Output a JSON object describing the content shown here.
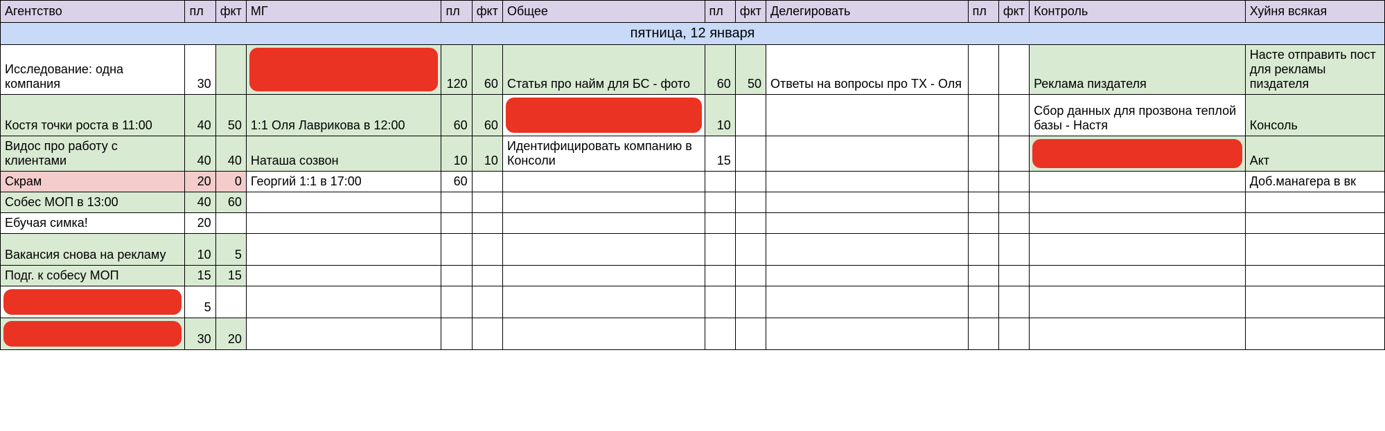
{
  "headers": {
    "agency": "Агентство",
    "pl": "пл",
    "fkt": "фкт",
    "mg": "МГ",
    "general": "Общее",
    "delegate": "Делегировать",
    "control": "Контроль",
    "misc": "Хуйня всякая"
  },
  "date_row": "пятница, 12 января",
  "rows": [
    {
      "agency": {
        "text": "Исследование: одна компания",
        "cls": ""
      },
      "a_pl": "30",
      "a_fkt": "",
      "a_pl_cls": "",
      "a_fkt_cls": "green",
      "mg": {
        "text": "",
        "cls": "green redact"
      },
      "m_pl": "120",
      "m_fkt": "60",
      "m_pl_cls": "green",
      "m_fkt_cls": "green",
      "gen": {
        "text": "Статья про найм для БС - фото",
        "cls": "green"
      },
      "g_pl": "60",
      "g_fkt": "50",
      "g_pl_cls": "green",
      "g_fkt_cls": "green",
      "del": {
        "text": "Ответы на вопросы про ТХ - Оля",
        "cls": ""
      },
      "d_pl": "",
      "d_fkt": "",
      "ctrl": {
        "text": "Реклама пиздателя",
        "cls": "green"
      },
      "misc": {
        "text": "Насте отправить пост для рекламы пиздателя",
        "cls": "green"
      },
      "h": "tall"
    },
    {
      "agency": {
        "text": "Костя точки роста в 11:00",
        "cls": "green"
      },
      "a_pl": "40",
      "a_fkt": "50",
      "a_pl_cls": "green",
      "a_fkt_cls": "green",
      "mg": {
        "text": "1:1 Оля Лаврикова в 12:00",
        "cls": "green"
      },
      "m_pl": "60",
      "m_fkt": "60",
      "m_pl_cls": "green",
      "m_fkt_cls": "green",
      "gen": {
        "text": "",
        "cls": "redact"
      },
      "g_pl": "10",
      "g_fkt": "",
      "g_pl_cls": "green",
      "g_fkt_cls": "",
      "del": {
        "text": "",
        "cls": ""
      },
      "d_pl": "",
      "d_fkt": "",
      "ctrl": {
        "text": "Сбор данных для прозвона теплой базы - Настя",
        "cls": ""
      },
      "misc": {
        "text": "Консоль",
        "cls": "green"
      },
      "h": "tall"
    },
    {
      "agency": {
        "text": "Видос про работу с клиентами",
        "cls": "green"
      },
      "a_pl": "40",
      "a_fkt": "40",
      "a_pl_cls": "green",
      "a_fkt_cls": "green",
      "mg": {
        "text": "Наташа созвон",
        "cls": "green"
      },
      "m_pl": "10",
      "m_fkt": "10",
      "m_pl_cls": "green",
      "m_fkt_cls": "green",
      "gen": {
        "text": "Идентифицировать компанию в Консоли",
        "cls": ""
      },
      "g_pl": "15",
      "g_fkt": "",
      "g_pl_cls": "",
      "g_fkt_cls": "",
      "del": {
        "text": "",
        "cls": ""
      },
      "d_pl": "",
      "d_fkt": "",
      "ctrl": {
        "text": "",
        "cls": "green redact"
      },
      "misc": {
        "text": "Акт",
        "cls": "green"
      },
      "h": "med"
    },
    {
      "agency": {
        "text": "Скрам",
        "cls": "pink"
      },
      "a_pl": "20",
      "a_fkt": "0",
      "a_pl_cls": "pink",
      "a_fkt_cls": "pink",
      "mg": {
        "text": "Георгий 1:1 в 17:00",
        "cls": ""
      },
      "m_pl": "60",
      "m_fkt": "",
      "m_pl_cls": "",
      "m_fkt_cls": "",
      "gen": {
        "text": "",
        "cls": ""
      },
      "g_pl": "",
      "g_fkt": "",
      "g_pl_cls": "",
      "g_fkt_cls": "",
      "del": {
        "text": "",
        "cls": ""
      },
      "d_pl": "",
      "d_fkt": "",
      "ctrl": {
        "text": "",
        "cls": ""
      },
      "misc": {
        "text": "Доб.манагера в вк",
        "cls": ""
      },
      "h": ""
    },
    {
      "agency": {
        "text": "Собес МОП в 13:00",
        "cls": "green"
      },
      "a_pl": "40",
      "a_fkt": "60",
      "a_pl_cls": "green",
      "a_fkt_cls": "green",
      "mg": {
        "text": "",
        "cls": ""
      },
      "m_pl": "",
      "m_fkt": "",
      "m_pl_cls": "",
      "m_fkt_cls": "",
      "gen": {
        "text": "",
        "cls": ""
      },
      "g_pl": "",
      "g_fkt": "",
      "g_pl_cls": "",
      "g_fkt_cls": "",
      "del": {
        "text": "",
        "cls": ""
      },
      "d_pl": "",
      "d_fkt": "",
      "ctrl": {
        "text": "",
        "cls": ""
      },
      "misc": {
        "text": "",
        "cls": ""
      },
      "h": ""
    },
    {
      "agency": {
        "text": "Ебучая симка!",
        "cls": ""
      },
      "a_pl": "20",
      "a_fkt": "",
      "a_pl_cls": "",
      "a_fkt_cls": "",
      "mg": {
        "text": "",
        "cls": ""
      },
      "m_pl": "",
      "m_fkt": "",
      "m_pl_cls": "",
      "m_fkt_cls": "",
      "gen": {
        "text": "",
        "cls": ""
      },
      "g_pl": "",
      "g_fkt": "",
      "g_pl_cls": "",
      "g_fkt_cls": "",
      "del": {
        "text": "",
        "cls": ""
      },
      "d_pl": "",
      "d_fkt": "",
      "ctrl": {
        "text": "",
        "cls": ""
      },
      "misc": {
        "text": "",
        "cls": ""
      },
      "h": ""
    },
    {
      "agency": {
        "text": "Вакансия снова на рекламу",
        "cls": "green"
      },
      "a_pl": "10",
      "a_fkt": "5",
      "a_pl_cls": "green",
      "a_fkt_cls": "green",
      "mg": {
        "text": "",
        "cls": ""
      },
      "m_pl": "",
      "m_fkt": "",
      "m_pl_cls": "",
      "m_fkt_cls": "",
      "gen": {
        "text": "",
        "cls": ""
      },
      "g_pl": "",
      "g_fkt": "",
      "g_pl_cls": "",
      "g_fkt_cls": "",
      "del": {
        "text": "",
        "cls": ""
      },
      "d_pl": "",
      "d_fkt": "",
      "ctrl": {
        "text": "",
        "cls": ""
      },
      "misc": {
        "text": "",
        "cls": ""
      },
      "h": "med"
    },
    {
      "agency": {
        "text": "Подг. к собесу МОП",
        "cls": "green"
      },
      "a_pl": "15",
      "a_fkt": "15",
      "a_pl_cls": "green",
      "a_fkt_cls": "green",
      "mg": {
        "text": "",
        "cls": ""
      },
      "m_pl": "",
      "m_fkt": "",
      "m_pl_cls": "",
      "m_fkt_cls": "",
      "gen": {
        "text": "",
        "cls": ""
      },
      "g_pl": "",
      "g_fkt": "",
      "g_pl_cls": "",
      "g_fkt_cls": "",
      "del": {
        "text": "",
        "cls": ""
      },
      "d_pl": "",
      "d_fkt": "",
      "ctrl": {
        "text": "",
        "cls": ""
      },
      "misc": {
        "text": "",
        "cls": ""
      },
      "h": ""
    },
    {
      "agency": {
        "text": "",
        "cls": "redact"
      },
      "a_pl": "5",
      "a_fkt": "",
      "a_pl_cls": "",
      "a_fkt_cls": "",
      "mg": {
        "text": "",
        "cls": ""
      },
      "m_pl": "",
      "m_fkt": "",
      "m_pl_cls": "",
      "m_fkt_cls": "",
      "gen": {
        "text": "",
        "cls": ""
      },
      "g_pl": "",
      "g_fkt": "",
      "g_pl_cls": "",
      "g_fkt_cls": "",
      "del": {
        "text": "",
        "cls": ""
      },
      "d_pl": "",
      "d_fkt": "",
      "ctrl": {
        "text": "",
        "cls": ""
      },
      "misc": {
        "text": "",
        "cls": ""
      },
      "h": "med"
    },
    {
      "agency": {
        "text": "",
        "cls": "green redact"
      },
      "a_pl": "30",
      "a_fkt": "20",
      "a_pl_cls": "green",
      "a_fkt_cls": "green",
      "mg": {
        "text": "",
        "cls": ""
      },
      "m_pl": "",
      "m_fkt": "",
      "m_pl_cls": "",
      "m_fkt_cls": "",
      "gen": {
        "text": "",
        "cls": ""
      },
      "g_pl": "",
      "g_fkt": "",
      "g_pl_cls": "",
      "g_fkt_cls": "",
      "del": {
        "text": "",
        "cls": ""
      },
      "d_pl": "",
      "d_fkt": "",
      "ctrl": {
        "text": "",
        "cls": ""
      },
      "misc": {
        "text": "",
        "cls": ""
      },
      "h": "med"
    }
  ]
}
